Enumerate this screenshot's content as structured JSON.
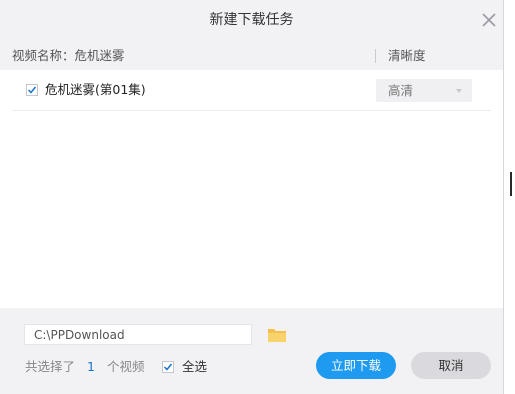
{
  "dialog": {
    "title": "新建下载任务",
    "close_icon": "close-x-icon"
  },
  "table": {
    "header_name": "视频名称：危机迷雾",
    "header_definition": "清晰度",
    "rows": [
      {
        "checked": true,
        "title": "危机迷雾(第01集)",
        "quality": "高清"
      }
    ]
  },
  "footer": {
    "path_value": "C:\\PPDownload",
    "folder_icon": "folder-icon",
    "selected_prefix": "共选择了",
    "selected_count": "1",
    "selected_suffix": "个视频",
    "select_all_checked": true,
    "select_all_label": "全选",
    "download_button": "立即下载",
    "cancel_button": "取消"
  },
  "colors": {
    "accent": "#1e9af0",
    "dialog_bg": "#f2f2f5",
    "count_blue": "#1a73c7"
  }
}
